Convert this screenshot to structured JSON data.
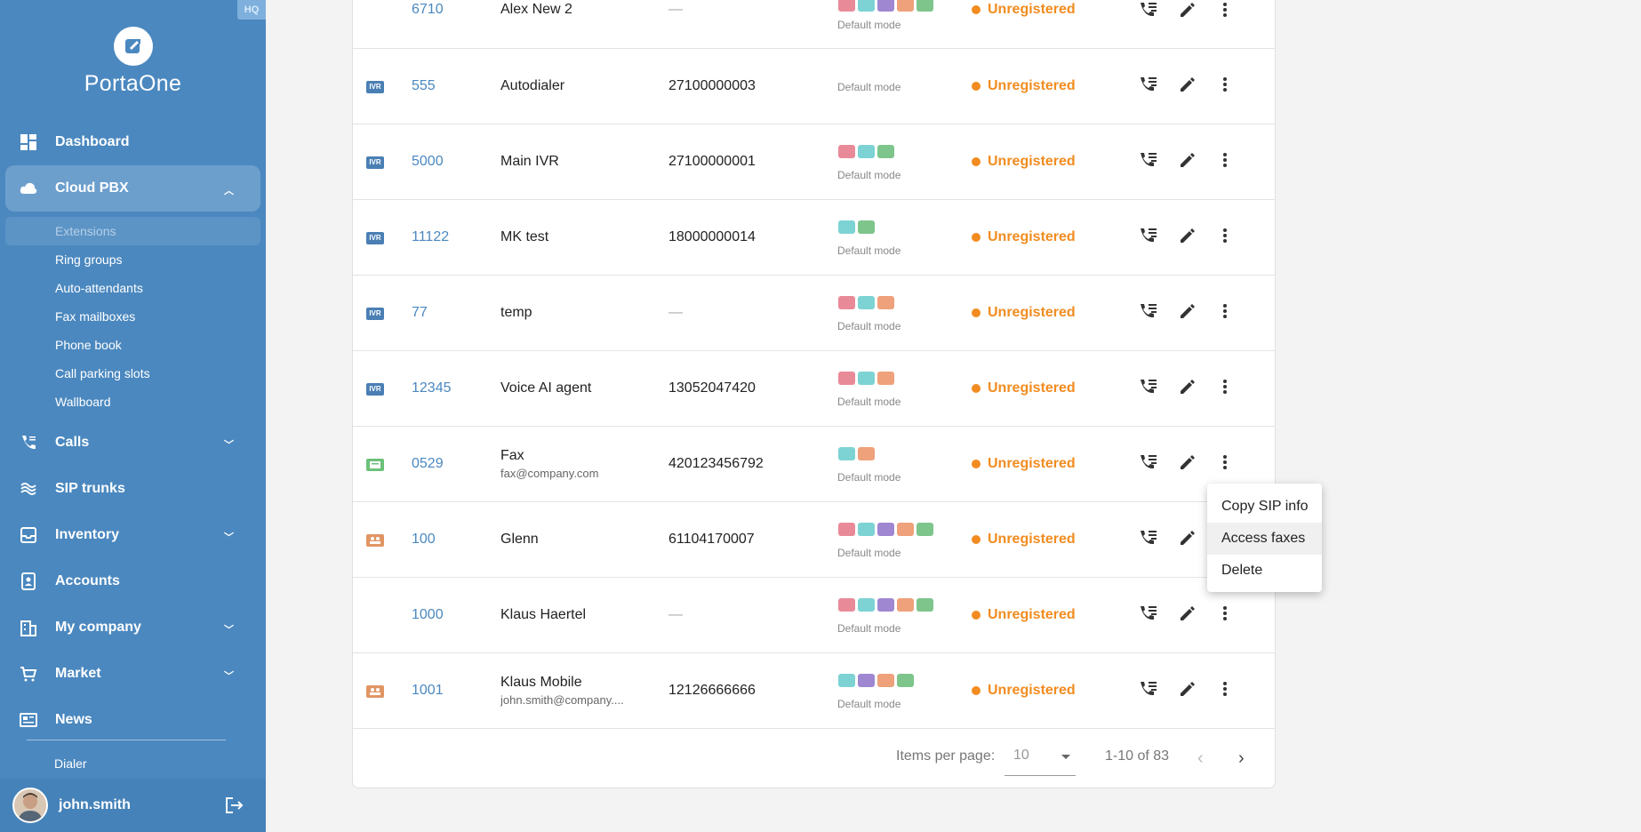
{
  "sidebar": {
    "hq_label": "HQ",
    "brand": "PortaOne",
    "nav": {
      "dashboard": "Dashboard",
      "cloud_pbx": "Cloud PBX",
      "calls": "Calls",
      "sip_trunks": "SIP trunks",
      "inventory": "Inventory",
      "accounts": "Accounts",
      "my_company": "My company",
      "market": "Market",
      "news": "News"
    },
    "cloud_pbx_sub": {
      "extensions": "Extensions",
      "ring_groups": "Ring groups",
      "auto_attendants": "Auto-attendants",
      "fax_mailboxes": "Fax mailboxes",
      "phone_book": "Phone book",
      "call_parking_slots": "Call parking slots",
      "wallboard": "Wallboard"
    },
    "dialer": "Dialer",
    "user": "john.smith"
  },
  "rows": [
    {
      "badge": "",
      "ext": "6710",
      "name": "Alex New 2",
      "email": "",
      "phone": "—",
      "mode": "Default mode",
      "status": "Unregistered"
    },
    {
      "badge": "IVR",
      "ext": "555",
      "name": "Autodialer",
      "email": "",
      "phone": "27100000003",
      "mode": "Default mode",
      "status": "Unregistered"
    },
    {
      "badge": "IVR",
      "ext": "5000",
      "name": "Main IVR",
      "email": "",
      "phone": "27100000001",
      "mode": "Default mode",
      "status": "Unregistered"
    },
    {
      "badge": "IVR",
      "ext": "11122",
      "name": "MK test",
      "email": "",
      "phone": "18000000014",
      "mode": "Default mode",
      "status": "Unregistered"
    },
    {
      "badge": "IVR",
      "ext": "77",
      "name": "temp",
      "email": "",
      "phone": "—",
      "mode": "Default mode",
      "status": "Unregistered"
    },
    {
      "badge": "IVR",
      "ext": "12345",
      "name": "Voice AI agent",
      "email": "",
      "phone": "13052047420",
      "mode": "Default mode",
      "status": "Unregistered"
    },
    {
      "badge": "",
      "ext": "0529",
      "name": "Fax",
      "email": "fax@company.com",
      "phone": "420123456792",
      "mode": "Default mode",
      "status": "Unregistered"
    },
    {
      "badge": "",
      "ext": "100",
      "name": "Glenn",
      "email": "",
      "phone": "61104170007",
      "mode": "Default mode",
      "status": "Unregistered"
    },
    {
      "badge": "",
      "ext": "1000",
      "name": "Klaus Haertel",
      "email": "",
      "phone": "—",
      "mode": "Default mode",
      "status": "Unregistered"
    },
    {
      "badge": "",
      "ext": "1001",
      "name": "Klaus Mobile",
      "email": "john.smith@company....",
      "phone": "12126666666",
      "mode": "Default mode",
      "status": "Unregistered"
    }
  ],
  "context_menu": {
    "copy_sip": "Copy SIP info",
    "access_faxes": "Access faxes",
    "delete": "Delete"
  },
  "pagination": {
    "items_per_page_label": "Items per page:",
    "items_per_page_value": "10",
    "range": "1-10 of 83",
    "prev": "‹",
    "next": "›"
  }
}
